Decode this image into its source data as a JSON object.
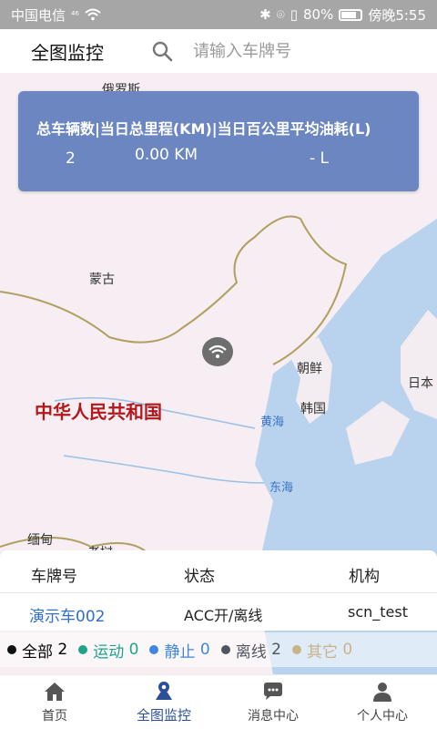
{
  "status_bar": {
    "carrier": "中国电信",
    "signal": "⁴⁶",
    "battery": "80%",
    "time": "傍晚5:55"
  },
  "header": {
    "title": "全图监控",
    "search_placeholder": "请输入车牌号"
  },
  "summary": {
    "header": "总车辆数|当日总里程(KM)|当日百公里平均油耗(L)",
    "total_vehicles": "2",
    "total_mileage": "0.00 KM",
    "avg_fuel": "- L"
  },
  "map_labels": {
    "russia": "俄罗斯",
    "mongolia": "蒙古",
    "china": "中华人民共和国",
    "north_korea": "朝鲜",
    "south_korea": "韩国",
    "japan": "日本",
    "yellow_sea": "黄海",
    "east_sea": "东海",
    "myanmar": "缅甸",
    "laos": "老挝"
  },
  "vehicle_table": {
    "columns": [
      "车牌号",
      "状态",
      "机构"
    ],
    "rows": [
      {
        "plate": "演示车002",
        "status": "ACC开/离线",
        "org": "scn_test"
      }
    ]
  },
  "legend": [
    {
      "label": "全部",
      "count": "2",
      "color": "#111111"
    },
    {
      "label": "运动",
      "count": "0",
      "color": "#1fa38a"
    },
    {
      "label": "静止",
      "count": "0",
      "color": "#3f86e0"
    },
    {
      "label": "离线",
      "count": "2",
      "color": "#4f5662"
    },
    {
      "label": "其它",
      "count": "0",
      "color": "#c9b48a"
    }
  ],
  "tabs": [
    {
      "label": "首页",
      "icon": "home-icon"
    },
    {
      "label": "全图监控",
      "icon": "map-pin-icon"
    },
    {
      "label": "消息中心",
      "icon": "chat-icon"
    },
    {
      "label": "个人中心",
      "icon": "user-icon"
    }
  ],
  "colors": {
    "accent": "#2c4f9a",
    "summary_bg": "#6b86c1",
    "plate_link": "#2f6fd1"
  }
}
